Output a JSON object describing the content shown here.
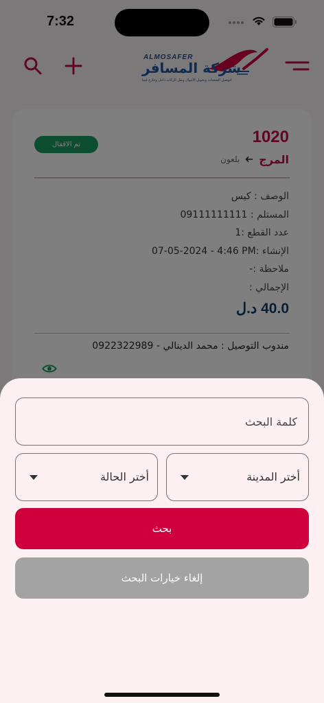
{
  "status_bar": {
    "time": "7:32"
  },
  "header": {
    "logo": {
      "latin": "ALMOSAFER",
      "arabic": "شركة المسافر",
      "tagline": "لتوصيل الشحنات وتحويل الأموال ونقل الركاب داخل وخارج ليبيا"
    }
  },
  "shipment": {
    "number": "1020",
    "status": "تم الاقفال",
    "route_from": "المرج",
    "route_to": "بلعون",
    "details": [
      {
        "label": "الوصف :",
        "value": " كيس"
      },
      {
        "label": "المستلم :",
        "value": " 09111111111"
      },
      {
        "label": "عدد القطع :",
        "value": "1"
      },
      {
        "label": "الإنشاء :",
        "value": " 07-05-2024 - 4:46 PM"
      },
      {
        "label": "ملاحظة :",
        "value": "-"
      },
      {
        "label": "الإجمالي :",
        "value": ""
      }
    ],
    "total": "40.0 د.ل",
    "courier_label": "مندوب التوصيل :",
    "courier_value": " محمد الدينالي - 0922322989"
  },
  "search_sheet": {
    "keyword_placeholder": "كلمة البحث",
    "city_select": "أختر المدينة",
    "status_select": "أختر الحالة",
    "search_button": "بحث",
    "cancel_button": "إلغاء خيارات البحث"
  },
  "colors": {
    "primary": "#d0003f",
    "brand_red": "#c10c45",
    "badge_green": "#1b9a63",
    "total_blue": "#0e3f6b"
  }
}
